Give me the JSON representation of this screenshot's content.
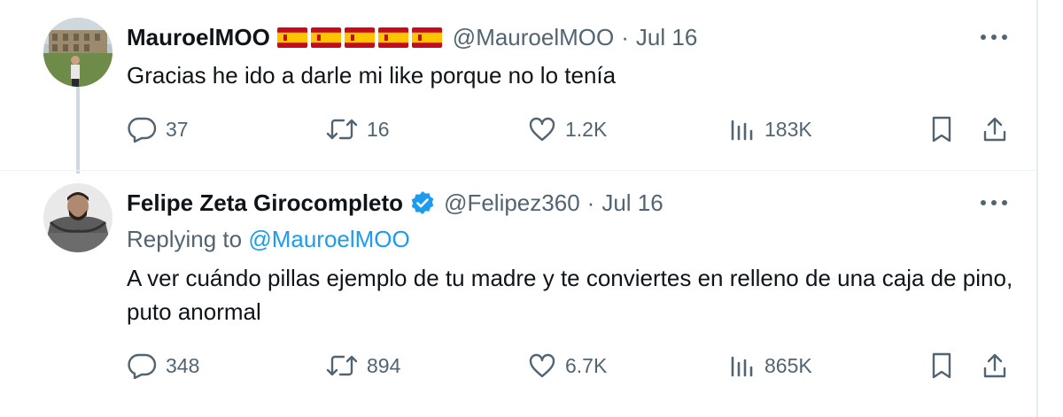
{
  "tweets": [
    {
      "display_name": "MauroelMOO",
      "handle": "@MauroelMOO",
      "separator": "·",
      "date": "Jul 16",
      "flags": [
        "spain-flag-icon",
        "spain-flag-icon",
        "spain-flag-icon",
        "spain-flag-icon",
        "spain-flag-icon"
      ],
      "text": "Gracias he ido a darle mi like porque no lo tenía",
      "stats": {
        "replies": "37",
        "reposts": "16",
        "likes": "1.2K",
        "views": "183K"
      }
    },
    {
      "display_name": "Felipe Zeta Girocompleto",
      "handle": "@Felipez360",
      "separator": "·",
      "date": "Jul 16",
      "verified": true,
      "replying_prefix": "Replying to",
      "replying_to": "@MauroelMOO",
      "text": "A ver cuándo pillas ejemplo de tu madre y te conviertes en relleno de una caja de pino, puto anormal",
      "stats": {
        "replies": "348",
        "reposts": "894",
        "likes": "6.7K",
        "views": "865K"
      }
    }
  ],
  "colors": {
    "text_primary": "#0f1419",
    "text_secondary": "#536471",
    "accent": "#1d9bf0",
    "thread_line": "#cfd9de"
  },
  "icons": {
    "more": "more-horizontal-icon",
    "reply": "reply-bubble-icon",
    "repost": "repost-arrows-icon",
    "like": "heart-icon",
    "views": "views-bar-chart-icon",
    "bookmark": "bookmark-icon",
    "share": "share-upload-icon"
  }
}
